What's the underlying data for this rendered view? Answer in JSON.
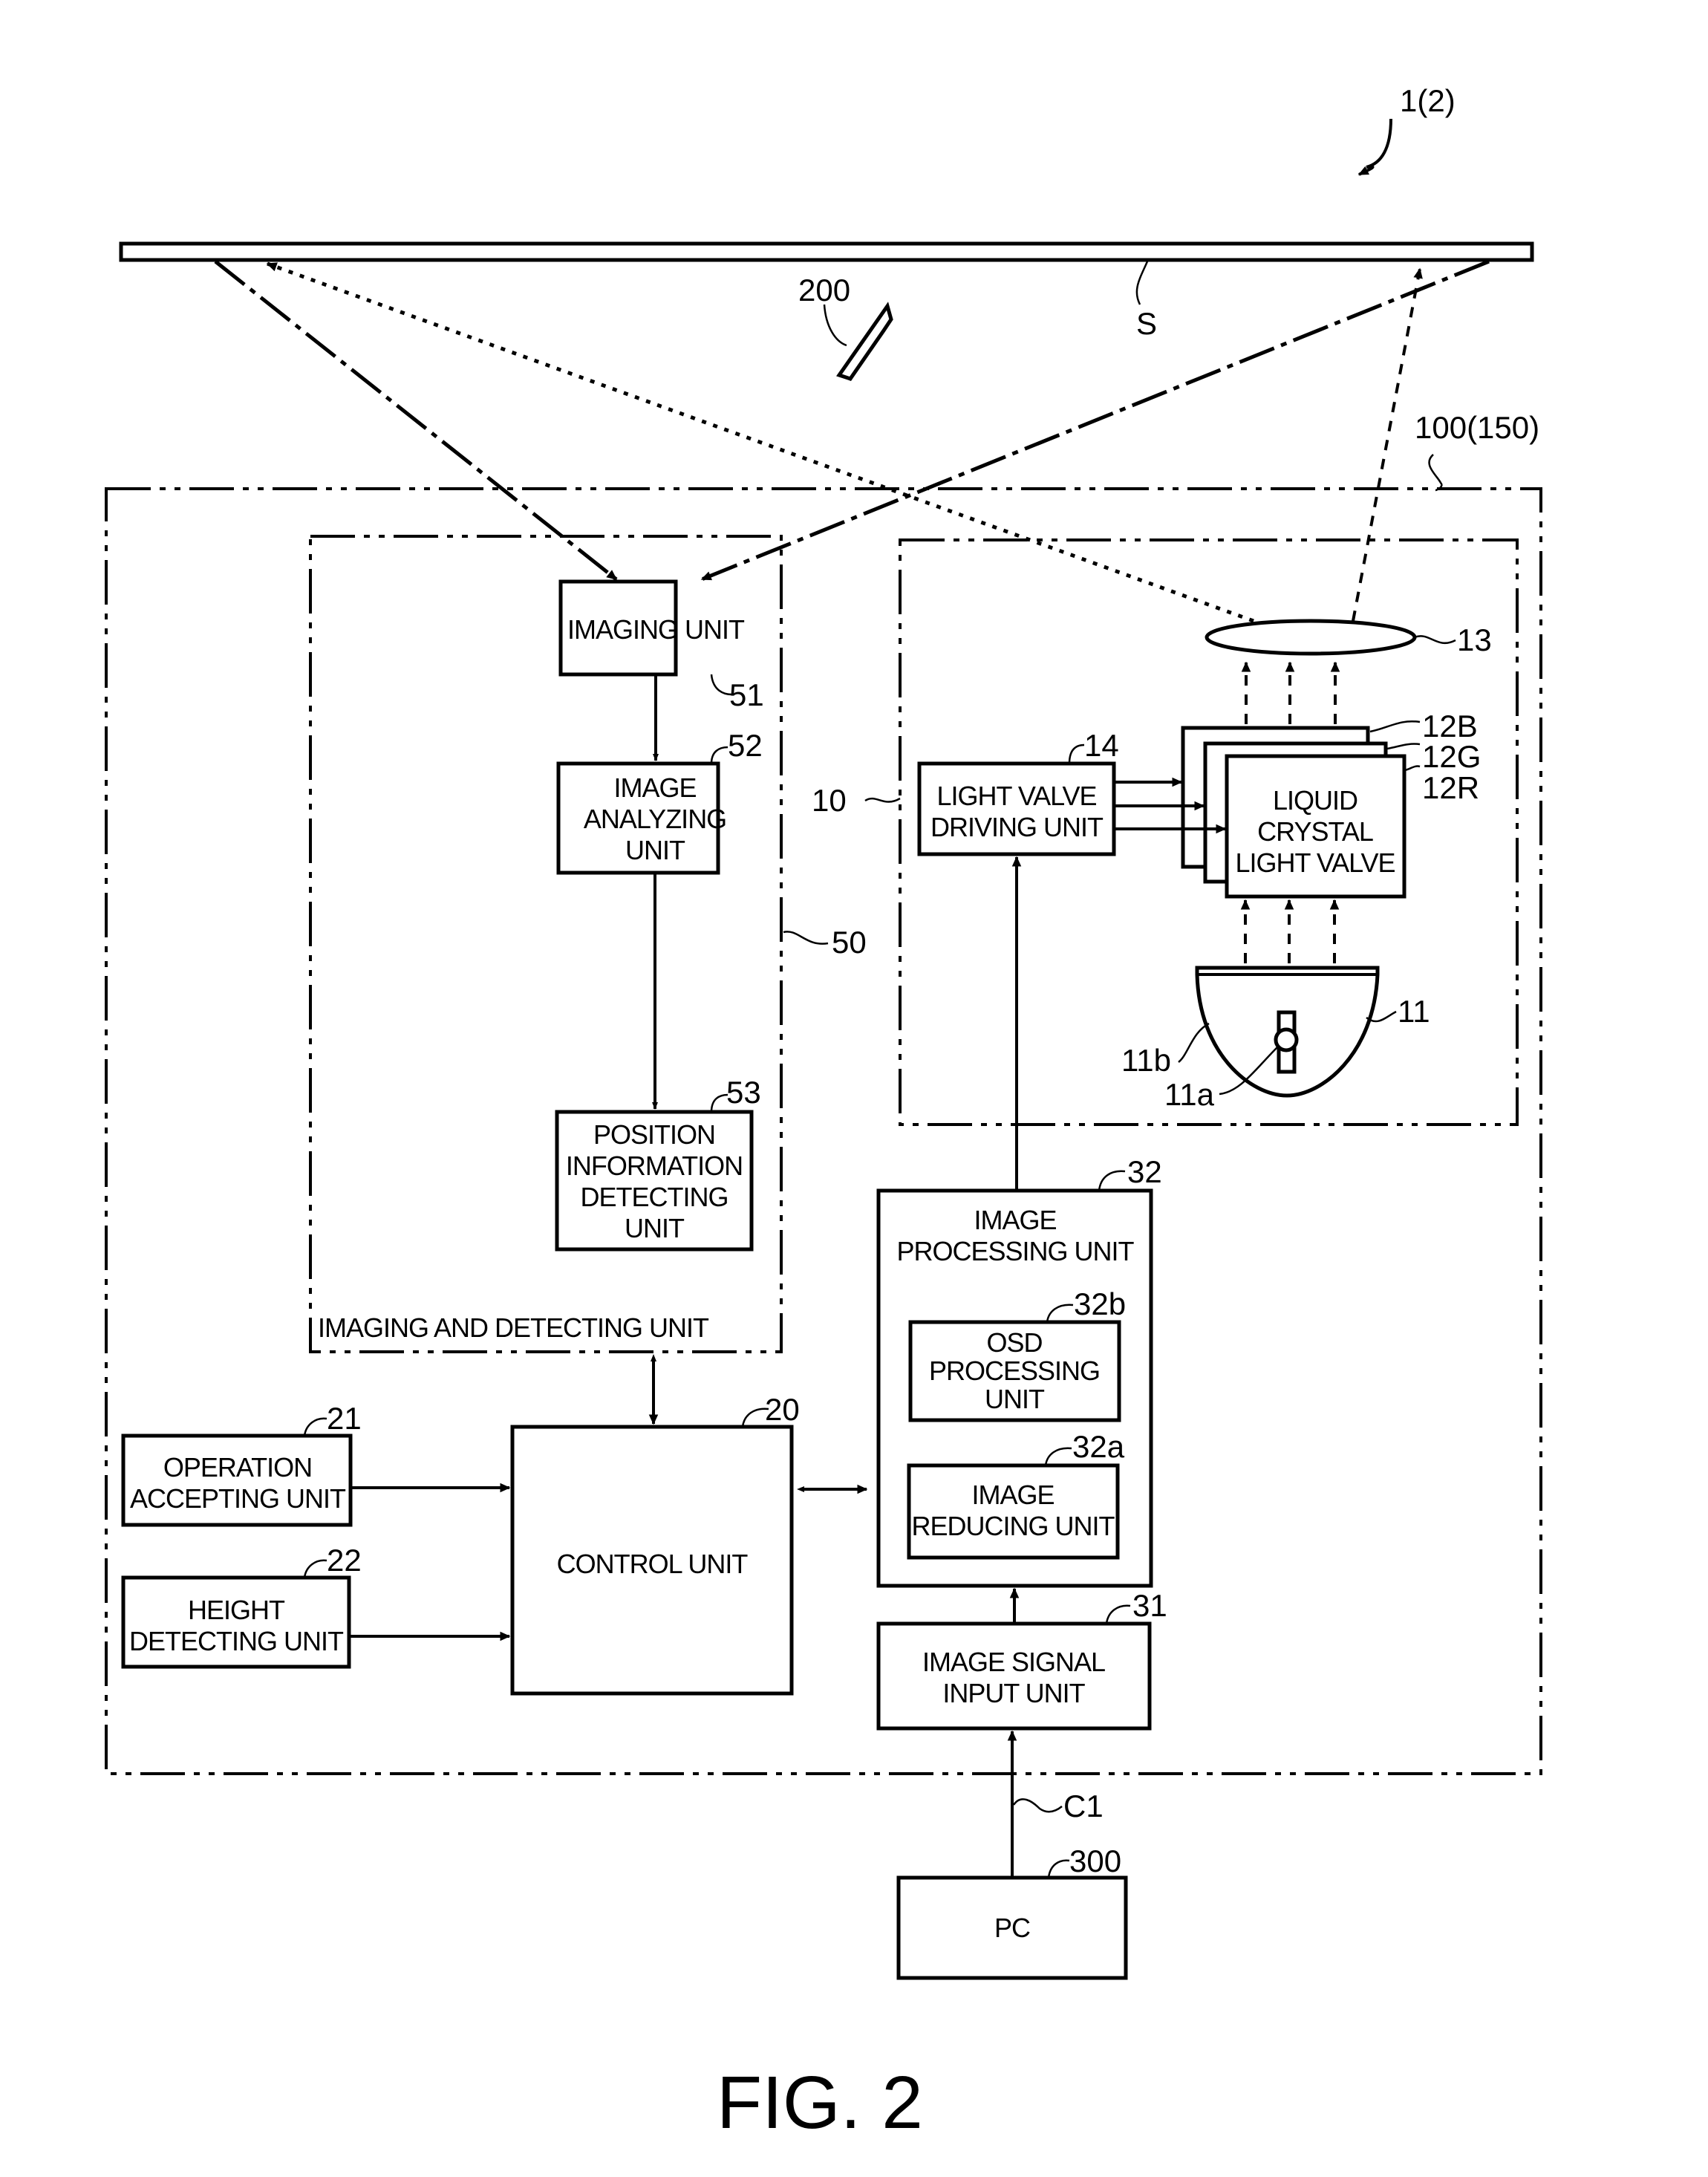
{
  "figure": {
    "caption": "FIG. 2",
    "system_ref": "1(2)"
  },
  "screen": {
    "ref": "S"
  },
  "pointer": {
    "ref": "200"
  },
  "projector": {
    "ref": "100(150)"
  },
  "imaging_and_detecting": {
    "ref": "50",
    "label": "IMAGING AND DETECTING UNIT",
    "imaging_unit": {
      "ref": "51",
      "lines": [
        "IMAGING UNIT"
      ]
    },
    "image_analyzing_unit": {
      "ref": "52",
      "lines": [
        "IMAGE",
        "ANALYZING",
        "UNIT"
      ]
    },
    "position_info_unit": {
      "ref": "53",
      "lines": [
        "POSITION",
        "INFORMATION",
        "DETECTING",
        "UNIT"
      ]
    }
  },
  "projection_unit": {
    "ref": "10",
    "lens": {
      "ref": "13"
    },
    "light_valve_driving": {
      "ref": "14",
      "lines": [
        "LIGHT VALVE",
        "DRIVING UNIT"
      ]
    },
    "light_valves": {
      "refs": [
        "12B",
        "12G",
        "12R"
      ],
      "lines": [
        "LIQUID",
        "CRYSTAL",
        "LIGHT VALVE"
      ]
    },
    "light_source": {
      "ref": "11",
      "lamp_ref": "11a",
      "reflector_ref": "11b"
    }
  },
  "image_processing": {
    "ref": "32",
    "lines": [
      "IMAGE",
      "PROCESSING UNIT"
    ],
    "osd": {
      "ref": "32b",
      "lines": [
        "OSD",
        "PROCESSING",
        "UNIT"
      ]
    },
    "reducing": {
      "ref": "32a",
      "lines": [
        "IMAGE",
        "REDUCING UNIT"
      ]
    }
  },
  "control_unit": {
    "ref": "20",
    "lines": [
      "CONTROL UNIT"
    ]
  },
  "operation_accepting": {
    "ref": "21",
    "lines": [
      "OPERATION",
      "ACCEPTING UNIT"
    ]
  },
  "height_detecting": {
    "ref": "22",
    "lines": [
      "HEIGHT",
      "DETECTING UNIT"
    ]
  },
  "image_signal_input": {
    "ref": "31",
    "lines": [
      "IMAGE SIGNAL",
      "INPUT UNIT"
    ]
  },
  "cable": {
    "ref": "C1"
  },
  "pc": {
    "ref": "300",
    "lines": [
      "PC"
    ]
  }
}
